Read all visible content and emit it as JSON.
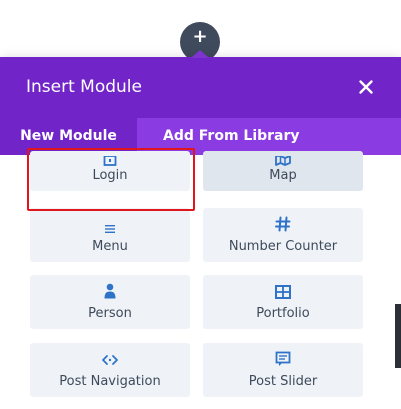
{
  "modal": {
    "title": "Insert Module",
    "tabs": [
      {
        "label": "New Module",
        "active": true
      },
      {
        "label": "Add From Library",
        "active": false
      }
    ]
  },
  "modules": [
    {
      "label": "Login",
      "icon": "login-icon",
      "highlighted": false
    },
    {
      "label": "Map",
      "icon": "map-icon",
      "highlighted": true
    },
    {
      "label": "Menu",
      "icon": "menu-icon",
      "highlighted": false,
      "selected": true
    },
    {
      "label": "Number Counter",
      "icon": "hash-icon",
      "highlighted": false
    },
    {
      "label": "Person",
      "icon": "person-icon",
      "highlighted": false
    },
    {
      "label": "Portfolio",
      "icon": "portfolio-icon",
      "highlighted": false
    },
    {
      "label": "Post Navigation",
      "icon": "post-navigation-icon",
      "highlighted": false
    },
    {
      "label": "Post Slider",
      "icon": "post-slider-icon",
      "highlighted": false
    }
  ],
  "colors": {
    "header": "#7125c8",
    "tabbar": "#8b3be2",
    "icon": "#2e73c7",
    "card": "#eff3f8",
    "selection_outline": "#e0161c"
  }
}
